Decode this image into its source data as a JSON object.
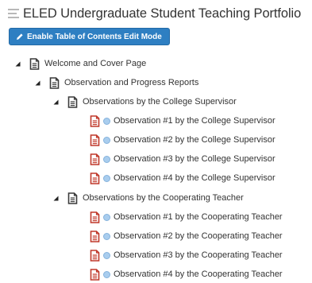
{
  "page": {
    "title": "ELED Undergraduate Student Teaching Portfolio"
  },
  "toolbar": {
    "edit_mode_label": "Enable Table of Contents Edit Mode"
  },
  "icons": {
    "list": "list-lines-icon",
    "pencil": "pencil-icon",
    "expand": "triangle-down-icon",
    "page": "document-icon",
    "status": "circle-dot-icon"
  },
  "colors": {
    "button_blue": "#2e7fc2",
    "document_dark": "#3a3a3a",
    "document_red": "#c0392b",
    "status_dot": "#a9cdee"
  },
  "tree": {
    "root": "Welcome and Cover Page",
    "section": "Observation and Progress Reports",
    "groups": [
      {
        "label": "Observations by the College Supervisor",
        "items": [
          "Observation #1 by the College Supervisor",
          "Observation #2 by the College Supervisor",
          "Observation #3 by the College Supervisor",
          "Observation #4 by the College Supervisor"
        ]
      },
      {
        "label": "Observations by the Cooperating Teacher",
        "items": [
          "Observation #1 by the Cooperating Teacher",
          "Observation #2 by the Cooperating Teacher",
          "Observation #3 by the Cooperating Teacher",
          "Observation #4 by the Cooperating Teacher"
        ]
      }
    ]
  }
}
